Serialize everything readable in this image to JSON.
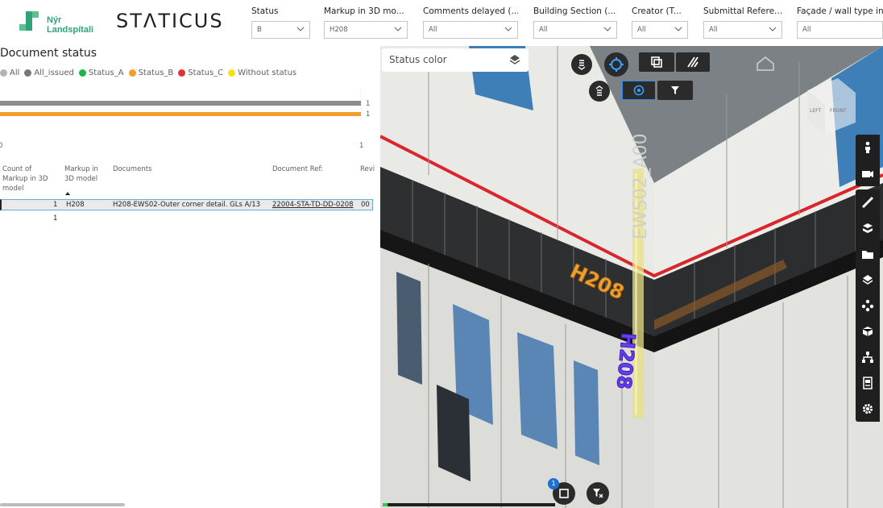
{
  "header": {
    "logo_nyr_line1": "Nýr",
    "logo_nyr_line2": "Landspítali",
    "logo_staticus": "STΛTICUS",
    "slicers": [
      {
        "title": "Status",
        "value": "B"
      },
      {
        "title": "Markup in 3D mo...",
        "value": "H208"
      },
      {
        "title": "Comments delayed (...",
        "value": "All"
      },
      {
        "title": "Building Section (...",
        "value": "All"
      },
      {
        "title": "Creator (T...",
        "value": "All"
      },
      {
        "title": "Submittal Refere...",
        "value": "All"
      },
      {
        "title": "Façade / wall type in 3...",
        "value": "All"
      }
    ]
  },
  "left": {
    "title": "Document status",
    "legend": [
      {
        "label": "All",
        "color": "#b3b3b3"
      },
      {
        "label": "All_issued",
        "color": "#777777"
      },
      {
        "label": "Status_A",
        "color": "#23b14d"
      },
      {
        "label": "Status_B",
        "color": "#f39c2b"
      },
      {
        "label": "Status_C",
        "color": "#e8312f"
      },
      {
        "label": "Without status",
        "color": "#f2e21a"
      }
    ],
    "chart_data": {
      "type": "bar",
      "orientation": "horizontal",
      "series": [
        {
          "name": "All_issued",
          "values": [
            1
          ]
        },
        {
          "name": "Status_B",
          "values": [
            1
          ]
        }
      ],
      "data_labels": [
        "1",
        "1"
      ],
      "x_ticks": [
        "0",
        "1"
      ],
      "xlim": [
        0,
        1
      ],
      "colors": [
        "#8c8c8c",
        "#f39c2b"
      ]
    },
    "table": {
      "headers": [
        "Count of Markup in 3D model",
        "Markup in 3D model",
        "Documents",
        "Document Ref:",
        "Revi"
      ],
      "rows": [
        {
          "count": "1",
          "markup": "H208",
          "document": "H208-EWS02-Outer corner detail. GLs A/13",
          "ref": "22004-STA-TD-DD-0208",
          "rev": "00"
        }
      ],
      "total": "1"
    }
  },
  "viewer": {
    "status_color_label": "Status color",
    "label_h208": "H208",
    "label_ews02": "EWS02_A00",
    "cube_left": "LEFT",
    "cube_front": "FRONT",
    "badge_count": "1",
    "progress_value": 0.03
  }
}
